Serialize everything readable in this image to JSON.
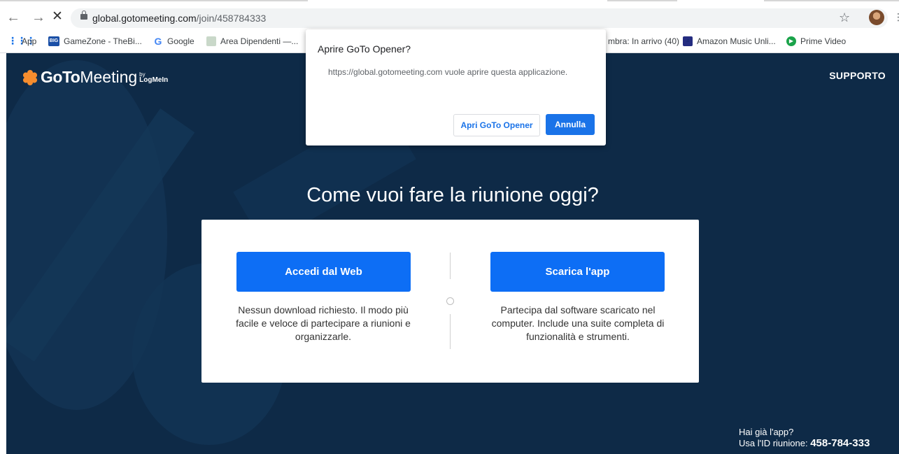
{
  "browser": {
    "url_host": "global.gotomeeting.com",
    "url_path": "/join/458784333",
    "bookmarks": [
      {
        "icon": "apps-grid-icon",
        "label": "App"
      },
      {
        "icon": "gamezone-icon",
        "label": "GameZone - TheBi..."
      },
      {
        "icon": "google-icon",
        "label": "Google"
      },
      {
        "icon": "area-dipendenti-icon",
        "label": "Area Dipendenti —..."
      },
      {
        "icon": "inbox-icon",
        "label": "mbra: In arrivo (40)"
      },
      {
        "icon": "amazon-music-icon",
        "label": "Amazon Music Unli..."
      },
      {
        "icon": "prime-video-icon",
        "label": "Prime Video"
      }
    ]
  },
  "dialog": {
    "title": "Aprire GoTo Opener?",
    "message": "https://global.gotomeeting.com vuole aprire questa applicazione.",
    "open_label": "Apri GoTo Opener",
    "cancel_label": "Annulla"
  },
  "header": {
    "logo_goto": "GoTo",
    "logo_meeting": "Meeting",
    "logo_by": "by",
    "logo_logmein": "LogMeIn",
    "support_label": "SUPPORTO"
  },
  "main": {
    "heading": "Come vuoi fare la riunione oggi?",
    "web_button": "Accedi dal Web",
    "web_description": "Nessun download richiesto. Il modo più facile e veloce di partecipare a riunioni e organizzarle.",
    "app_button": "Scarica l'app",
    "app_description": "Partecipa dal software scaricato nel computer. Include una suite completa di funzionalità e strumenti."
  },
  "footer": {
    "have_app": "Hai già l'app?",
    "meeting_id_label": "Usa l'ID riunione:",
    "meeting_id": "458-784-333"
  },
  "colors": {
    "page_background": "#0e2a47",
    "primary_button": "#0d6ef5",
    "logo_orange": "#f68d2e",
    "dialog_accent": "#1a73e8"
  }
}
